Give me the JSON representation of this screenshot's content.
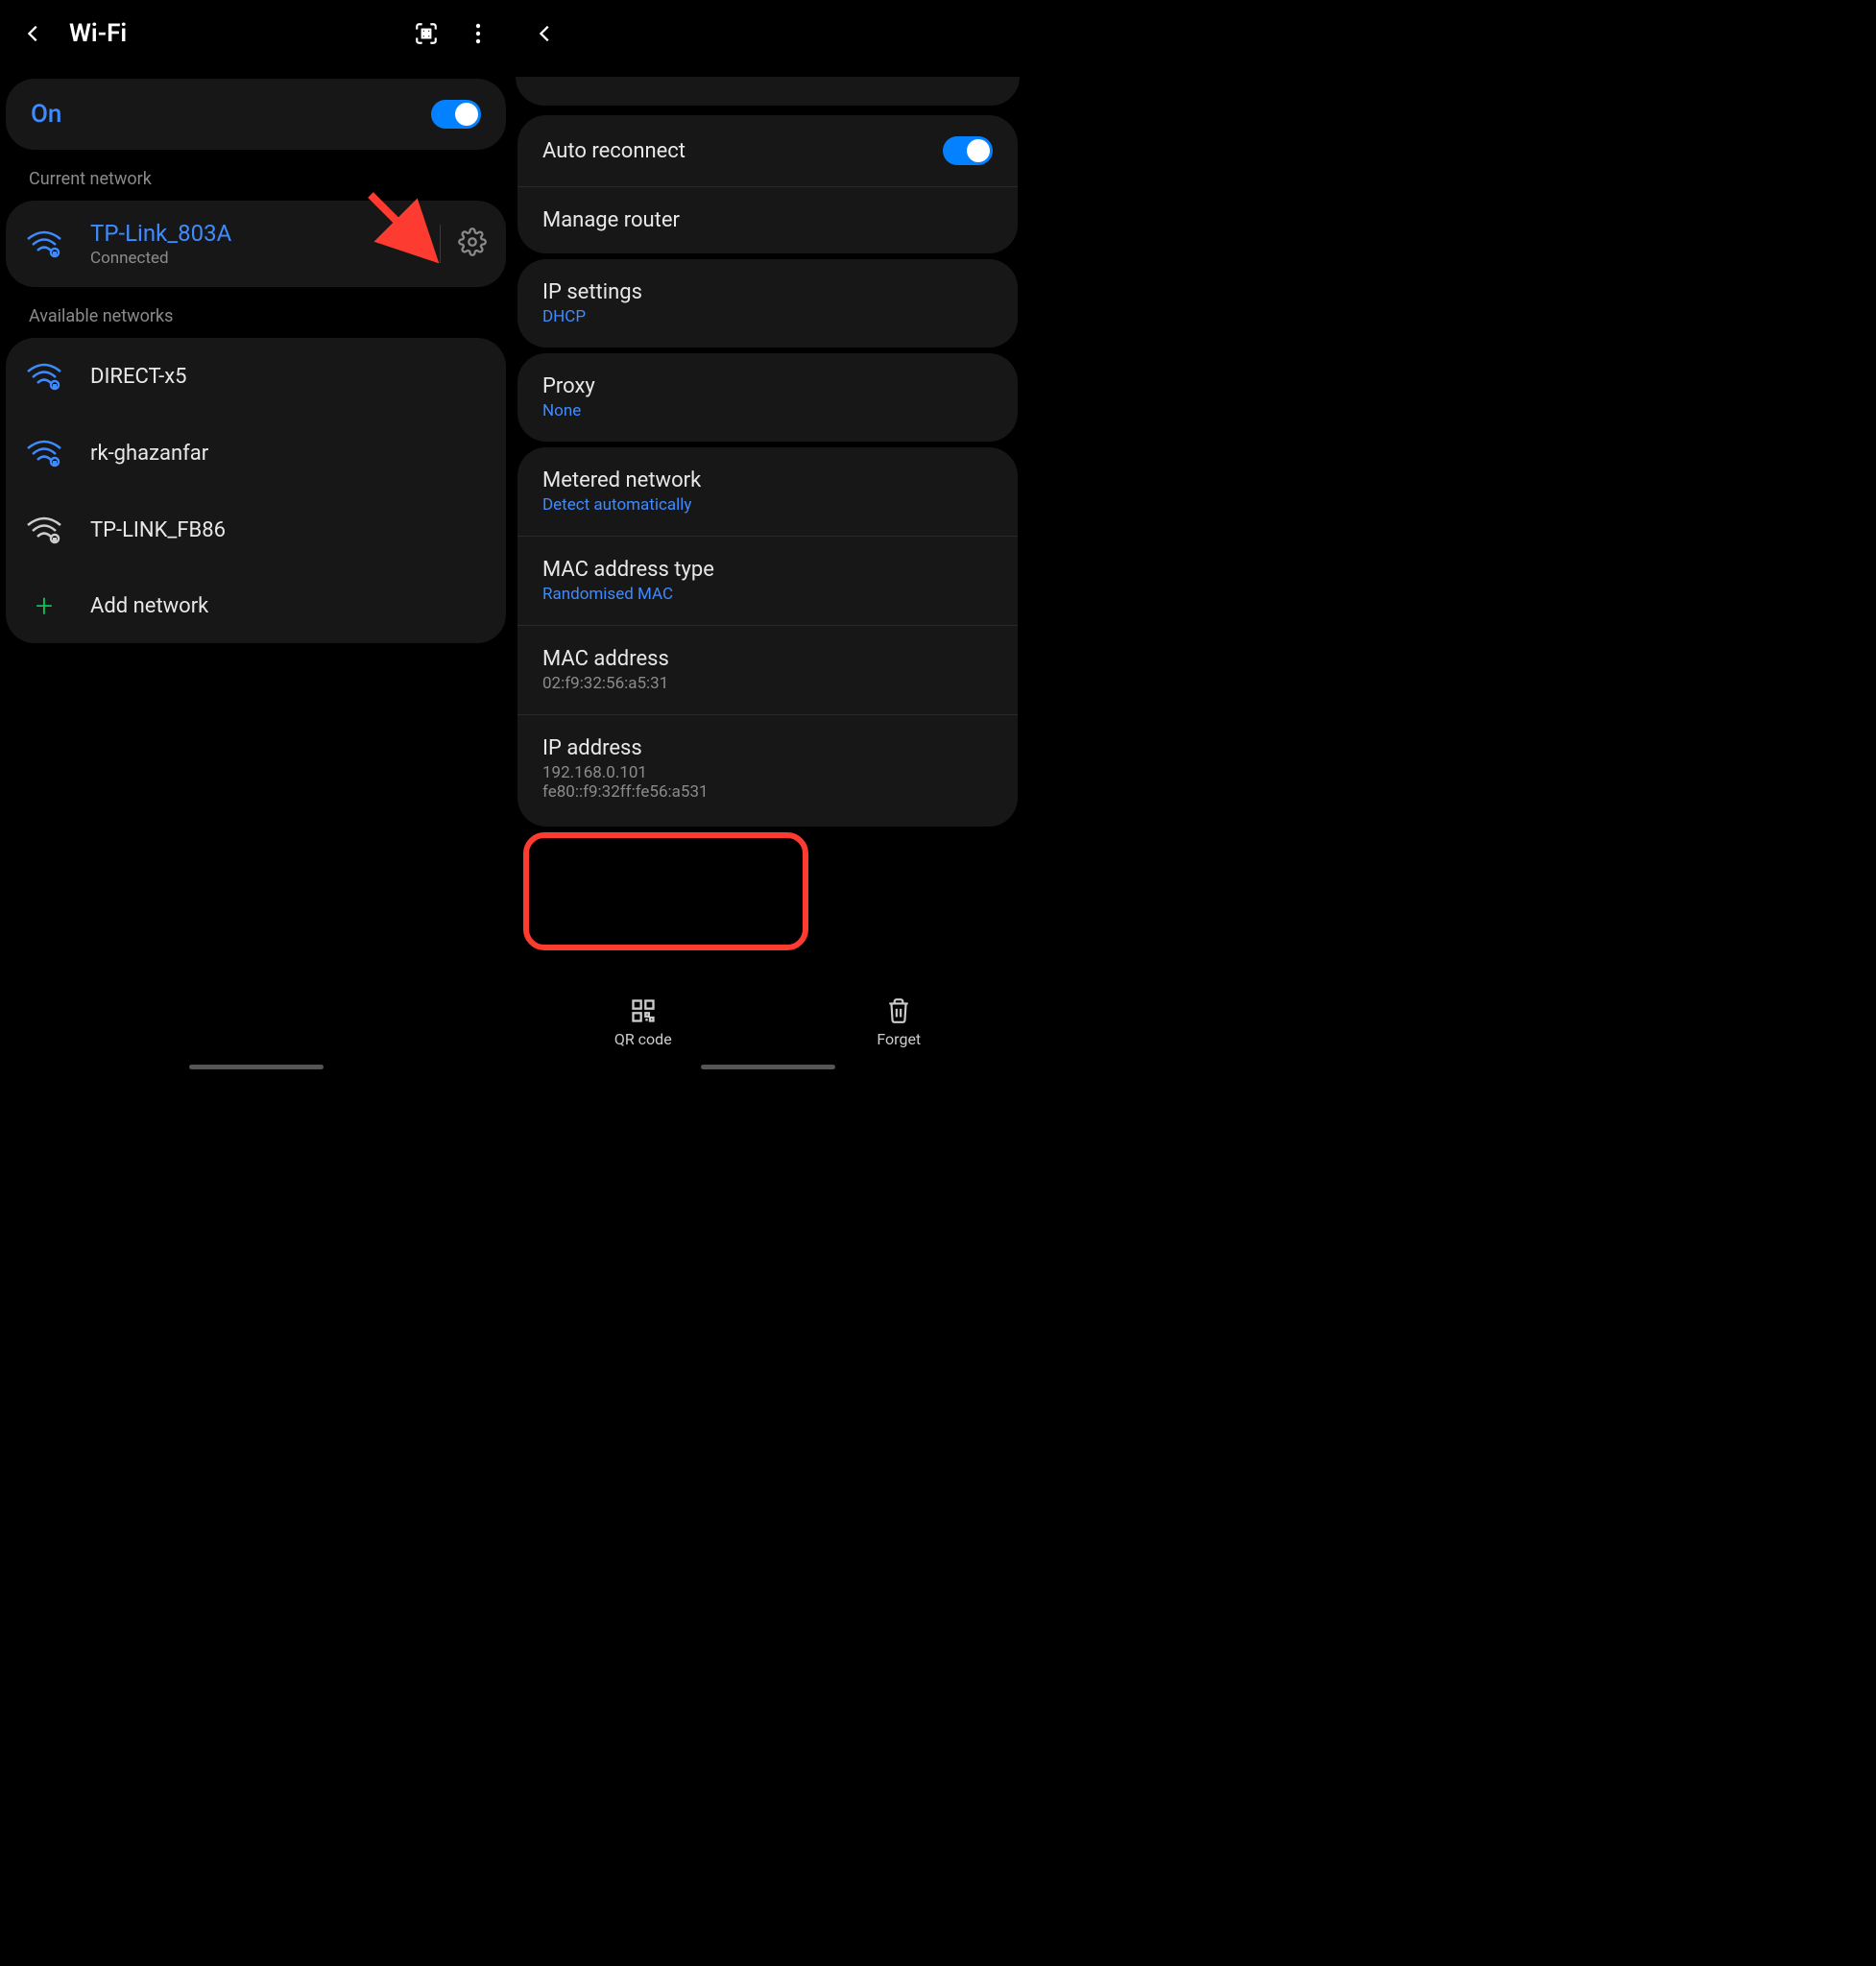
{
  "left": {
    "title": "Wi-Fi",
    "toggle_label": "On",
    "current_label": "Current network",
    "current": {
      "name": "TP-Link_803A",
      "status": "Connected"
    },
    "available_label": "Available networks",
    "networks": [
      "DIRECT-x5",
      "rk-ghazanfar",
      "TP-LINK_FB86"
    ],
    "add_label": "Add network"
  },
  "right": {
    "auto_reconnect": "Auto reconnect",
    "manage_router": "Manage router",
    "ip_settings": {
      "title": "IP settings",
      "value": "DHCP"
    },
    "proxy": {
      "title": "Proxy",
      "value": "None"
    },
    "metered": {
      "title": "Metered network",
      "value": "Detect automatically"
    },
    "mac_type": {
      "title": "MAC address type",
      "value": "Randomised MAC"
    },
    "mac_addr": {
      "title": "MAC address",
      "value": "02:f9:32:56:a5:31"
    },
    "ip_addr": {
      "title": "IP address",
      "v1": "192.168.0.101",
      "v2": "fe80::f9:32ff:fe56:a531"
    },
    "qr": "QR code",
    "forget": "Forget"
  }
}
